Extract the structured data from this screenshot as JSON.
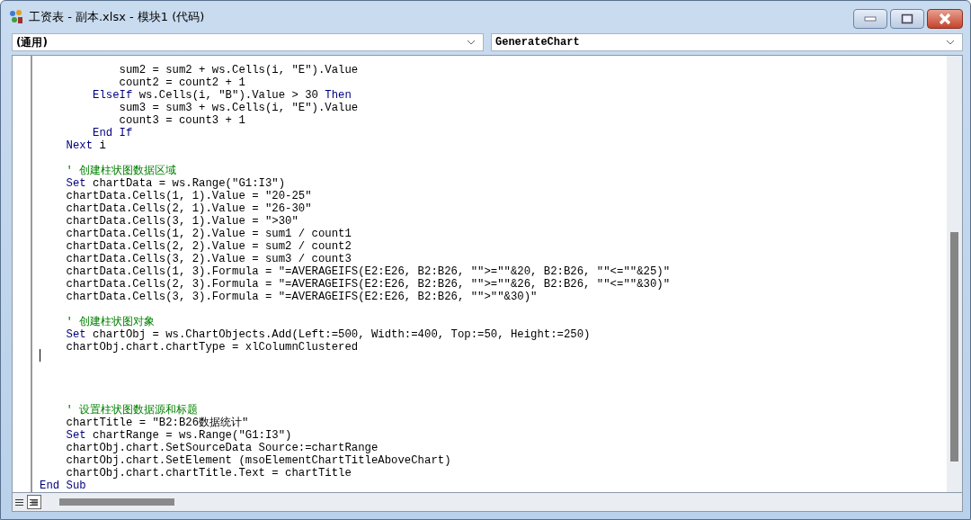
{
  "window": {
    "title": "工资表 - 副本.xlsx - 模块1 (代码)"
  },
  "object_combo": {
    "value": "(通用)"
  },
  "procedure_combo": {
    "value": "GenerateChart"
  },
  "code": {
    "lines": [
      {
        "kind": "code",
        "segments": [
          {
            "kind": "plain",
            "text": "            sum2 = sum2 + ws.Cells(i, \"E\").Value"
          }
        ]
      },
      {
        "kind": "code",
        "segments": [
          {
            "kind": "plain",
            "text": "            count2 = count2 + 1"
          }
        ]
      },
      {
        "kind": "code",
        "segments": [
          {
            "kind": "keyword",
            "text": "        ElseIf"
          },
          {
            "kind": "plain",
            "text": " ws.Cells(i, \"B\").Value > 30 "
          },
          {
            "kind": "keyword",
            "text": "Then"
          }
        ]
      },
      {
        "kind": "code",
        "segments": [
          {
            "kind": "plain",
            "text": "            sum3 = sum3 + ws.Cells(i, \"E\").Value"
          }
        ]
      },
      {
        "kind": "code",
        "segments": [
          {
            "kind": "plain",
            "text": "            count3 = count3 + 1"
          }
        ]
      },
      {
        "kind": "code",
        "segments": [
          {
            "kind": "keyword",
            "text": "        End If"
          }
        ]
      },
      {
        "kind": "code",
        "segments": [
          {
            "kind": "keyword",
            "text": "    Next"
          },
          {
            "kind": "plain",
            "text": " i"
          }
        ]
      },
      {
        "kind": "blank"
      },
      {
        "kind": "code",
        "segments": [
          {
            "kind": "comment",
            "text": "    ' 创建柱状图数据区域"
          }
        ]
      },
      {
        "kind": "code",
        "segments": [
          {
            "kind": "keyword",
            "text": "    Set"
          },
          {
            "kind": "plain",
            "text": " chartData = ws.Range(\"G1:I3\")"
          }
        ]
      },
      {
        "kind": "code",
        "segments": [
          {
            "kind": "plain",
            "text": "    chartData.Cells(1, 1).Value = \"20-25\""
          }
        ]
      },
      {
        "kind": "code",
        "segments": [
          {
            "kind": "plain",
            "text": "    chartData.Cells(2, 1).Value = \"26-30\""
          }
        ]
      },
      {
        "kind": "code",
        "segments": [
          {
            "kind": "plain",
            "text": "    chartData.Cells(3, 1).Value = \">30\""
          }
        ]
      },
      {
        "kind": "code",
        "segments": [
          {
            "kind": "plain",
            "text": "    chartData.Cells(1, 2).Value = sum1 / count1"
          }
        ]
      },
      {
        "kind": "code",
        "segments": [
          {
            "kind": "plain",
            "text": "    chartData.Cells(2, 2).Value = sum2 / count2"
          }
        ]
      },
      {
        "kind": "code",
        "segments": [
          {
            "kind": "plain",
            "text": "    chartData.Cells(3, 2).Value = sum3 / count3"
          }
        ]
      },
      {
        "kind": "code",
        "segments": [
          {
            "kind": "plain",
            "text": "    chartData.Cells(1, 3).Formula = \"=AVERAGEIFS(E2:E26, B2:B26, \"\">=\"\"&20, B2:B26, \"\"<=\"\"&25)\""
          }
        ]
      },
      {
        "kind": "code",
        "segments": [
          {
            "kind": "plain",
            "text": "    chartData.Cells(2, 3).Formula = \"=AVERAGEIFS(E2:E26, B2:B26, \"\">=\"\"&26, B2:B26, \"\"<=\"\"&30)\""
          }
        ]
      },
      {
        "kind": "code",
        "segments": [
          {
            "kind": "plain",
            "text": "    chartData.Cells(3, 3).Formula = \"=AVERAGEIFS(E2:E26, B2:B26, \"\">\"\"&30)\""
          }
        ]
      },
      {
        "kind": "blank"
      },
      {
        "kind": "code",
        "segments": [
          {
            "kind": "comment",
            "text": "    ' 创建柱状图对象"
          }
        ]
      },
      {
        "kind": "code",
        "segments": [
          {
            "kind": "keyword",
            "text": "    Set"
          },
          {
            "kind": "plain",
            "text": " chartObj = ws.ChartObjects.Add(Left:=500, Width:=400, Top:=50, Height:=250)"
          }
        ]
      },
      {
        "kind": "code",
        "segments": [
          {
            "kind": "plain",
            "text": "    chartObj.chart.chartType = xlColumnClustered"
          }
        ]
      },
      {
        "kind": "blank",
        "caret": true
      },
      {
        "kind": "blank"
      },
      {
        "kind": "blank"
      },
      {
        "kind": "blank"
      },
      {
        "kind": "code",
        "segments": [
          {
            "kind": "comment",
            "text": "    ' 设置柱状图数据源和标题"
          }
        ]
      },
      {
        "kind": "code",
        "segments": [
          {
            "kind": "plain",
            "text": "    chartTitle = \"B2:B26数据统计\""
          }
        ]
      },
      {
        "kind": "code",
        "segments": [
          {
            "kind": "keyword",
            "text": "    Set"
          },
          {
            "kind": "plain",
            "text": " chartRange = ws.Range(\"G1:I3\")"
          }
        ]
      },
      {
        "kind": "code",
        "segments": [
          {
            "kind": "plain",
            "text": "    chartObj.chart.SetSourceData Source:=chartRange"
          }
        ]
      },
      {
        "kind": "code",
        "segments": [
          {
            "kind": "plain",
            "text": "    chartObj.chart.SetElement (msoElementChartTitleAboveChart)"
          }
        ]
      },
      {
        "kind": "code",
        "segments": [
          {
            "kind": "plain",
            "text": "    chartObj.chart.chartTitle.Text = chartTitle"
          }
        ]
      },
      {
        "kind": "code",
        "segments": [
          {
            "kind": "keyword",
            "text": "End Sub"
          }
        ]
      }
    ]
  },
  "view_buttons": [
    {
      "kind": "procedure",
      "selected": false
    },
    {
      "kind": "module",
      "selected": true
    }
  ]
}
